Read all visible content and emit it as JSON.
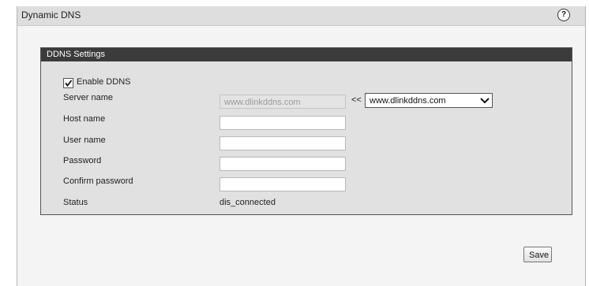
{
  "header": {
    "title": "Dynamic DNS",
    "help_icon": "?"
  },
  "panel": {
    "title": "DDNS Settings",
    "enable": {
      "label": "Enable DDNS",
      "checked": true
    },
    "server_name": {
      "label": "Server name",
      "value": "www.dlinkddns.com",
      "arrows": "<<",
      "select_value": "www.dlinkddns.com"
    },
    "host_name": {
      "label": "Host name",
      "value": ""
    },
    "user_name": {
      "label": "User name",
      "value": ""
    },
    "password": {
      "label": "Password",
      "value": ""
    },
    "confirm_password": {
      "label": "Confirm password",
      "value": ""
    },
    "status": {
      "label": "Status",
      "value": "dis_connected"
    }
  },
  "actions": {
    "save_label": "Save"
  }
}
